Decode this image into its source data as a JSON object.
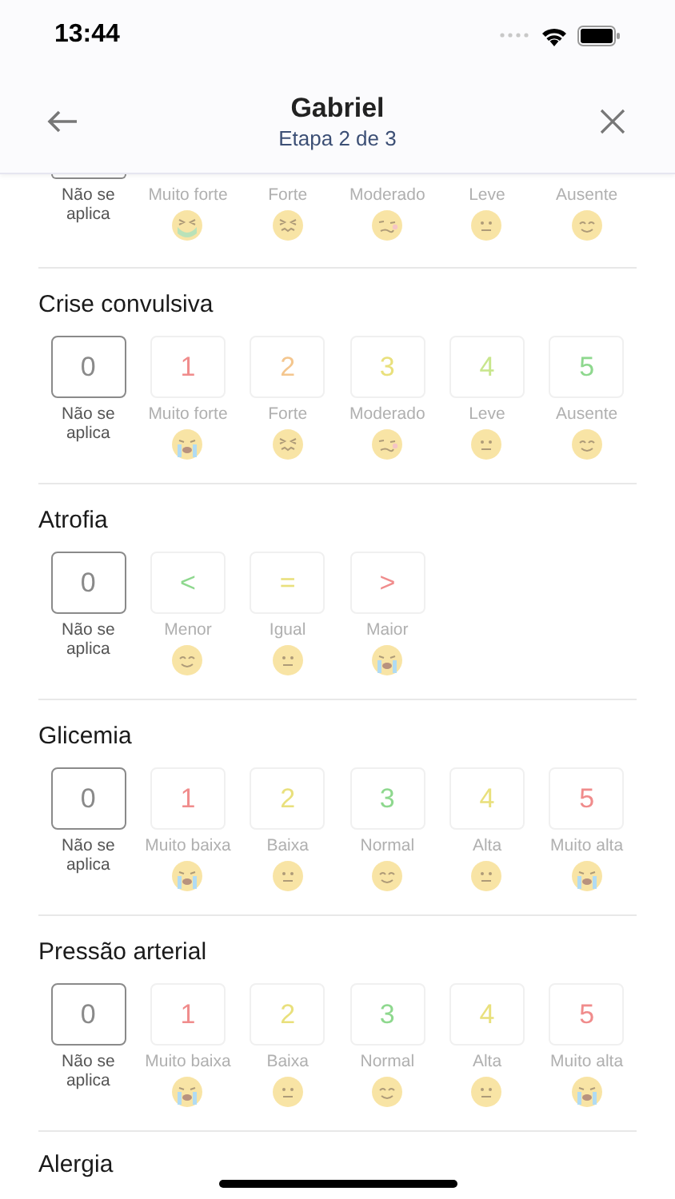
{
  "status_bar": {
    "time": "13:44"
  },
  "header": {
    "title": "Gabriel",
    "subtitle": "Etapa 2 de 3"
  },
  "scrolled_section": {
    "options": [
      {
        "label": "Não se aplica",
        "selected": true
      },
      {
        "label": "Muito forte",
        "selected": false,
        "kind": "sick"
      },
      {
        "label": "Forte",
        "selected": false,
        "kind": "squint"
      },
      {
        "label": "Moderado",
        "selected": false,
        "kind": "woozy"
      },
      {
        "label": "Leve",
        "selected": false,
        "kind": "neutral"
      },
      {
        "label": "Ausente",
        "selected": false,
        "kind": "smile"
      }
    ]
  },
  "sections": [
    {
      "title": "Crise convulsiva",
      "options": [
        {
          "value": "0",
          "label": "Não se aplica",
          "selected": true
        },
        {
          "value": "1",
          "label": "Muito forte",
          "selected": false,
          "color": "#f08c8c",
          "kind": "cry"
        },
        {
          "value": "2",
          "label": "Forte",
          "selected": false,
          "color": "#f4c68e",
          "kind": "squint"
        },
        {
          "value": "3",
          "label": "Moderado",
          "selected": false,
          "color": "#e9e07c",
          "kind": "woozy"
        },
        {
          "value": "4",
          "label": "Leve",
          "selected": false,
          "color": "#c8e68c",
          "kind": "neutral"
        },
        {
          "value": "5",
          "label": "Ausente",
          "selected": false,
          "color": "#8ed88e",
          "kind": "smile"
        }
      ]
    },
    {
      "title": "Atrofia",
      "options": [
        {
          "value": "0",
          "label": "Não se aplica",
          "selected": true
        },
        {
          "value": "<",
          "label": "Menor",
          "selected": false,
          "color": "#8ed88e",
          "kind": "smile"
        },
        {
          "value": "=",
          "label": "Igual",
          "selected": false,
          "color": "#e9e07c",
          "kind": "neutral"
        },
        {
          "value": ">",
          "label": "Maior",
          "selected": false,
          "color": "#f08c8c",
          "kind": "cry"
        }
      ]
    },
    {
      "title": "Glicemia",
      "options": [
        {
          "value": "0",
          "label": "Não se aplica",
          "selected": true
        },
        {
          "value": "1",
          "label": "Muito baixa",
          "selected": false,
          "color": "#f08c8c",
          "kind": "cry"
        },
        {
          "value": "2",
          "label": "Baixa",
          "selected": false,
          "color": "#e9e07c",
          "kind": "neutral"
        },
        {
          "value": "3",
          "label": "Normal",
          "selected": false,
          "color": "#8ed88e",
          "kind": "smile"
        },
        {
          "value": "4",
          "label": "Alta",
          "selected": false,
          "color": "#e9e07c",
          "kind": "neutral"
        },
        {
          "value": "5",
          "label": "Muito alta",
          "selected": false,
          "color": "#f08c8c",
          "kind": "cry"
        }
      ]
    },
    {
      "title": "Pressão arterial",
      "options": [
        {
          "value": "0",
          "label": "Não se aplica",
          "selected": true
        },
        {
          "value": "1",
          "label": "Muito baixa",
          "selected": false,
          "color": "#f08c8c",
          "kind": "cry"
        },
        {
          "value": "2",
          "label": "Baixa",
          "selected": false,
          "color": "#e9e07c",
          "kind": "neutral"
        },
        {
          "value": "3",
          "label": "Normal",
          "selected": false,
          "color": "#8ed88e",
          "kind": "smile"
        },
        {
          "value": "4",
          "label": "Alta",
          "selected": false,
          "color": "#e9e07c",
          "kind": "neutral"
        },
        {
          "value": "5",
          "label": "Muito alta",
          "selected": false,
          "color": "#f08c8c",
          "kind": "cry"
        }
      ]
    }
  ],
  "next_section": {
    "title": "Alergia"
  }
}
